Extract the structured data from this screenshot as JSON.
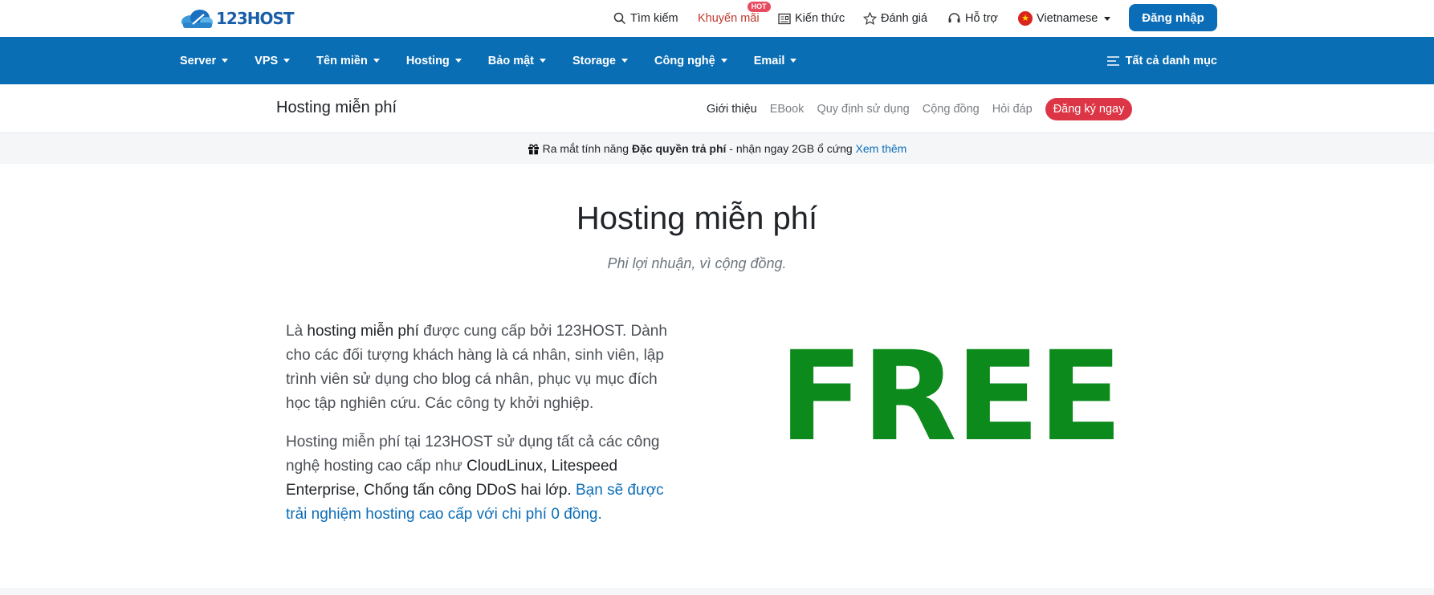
{
  "brand": {
    "logo_text": "123HOST"
  },
  "topbar": {
    "search_label": "Tìm kiếm",
    "promo_label": "Khuyến mãi",
    "promo_badge": "HOT",
    "knowledge_label": "Kiến thức",
    "review_label": "Đánh giá",
    "support_label": "Hỗ trợ",
    "language_label": "Vietnamese",
    "login_label": "Đăng nhập"
  },
  "mainnav": {
    "items": [
      {
        "label": "Server"
      },
      {
        "label": "VPS"
      },
      {
        "label": "Tên miền"
      },
      {
        "label": "Hosting"
      },
      {
        "label": "Bảo mật"
      },
      {
        "label": "Storage"
      },
      {
        "label": "Công nghệ"
      },
      {
        "label": "Email"
      }
    ],
    "all_categories_label": "Tất cả danh mục"
  },
  "subnav": {
    "title": "Hosting miễn phí",
    "links": [
      {
        "label": "Giới thiệu"
      },
      {
        "label": "EBook"
      },
      {
        "label": "Quy định sử dụng"
      },
      {
        "label": "Cộng đồng"
      },
      {
        "label": "Hỏi đáp"
      }
    ],
    "register_label": "Đăng ký ngay"
  },
  "announcement": {
    "prefix": "Ra mắt tính năng",
    "highlight": "Đặc quyền trả phí",
    "suffix": "- nhận ngay 2GB ổ cứng",
    "link_label": "Xem thêm"
  },
  "hero": {
    "title": "Hosting miễn phí",
    "subtitle": "Phi lợi nhuận, vì cộng đồng."
  },
  "content": {
    "p1_prefix": "Là",
    "p1_strong": "hosting miễn phí",
    "p1_rest": "được cung cấp bởi 123HOST. Dành cho các đối tượng khách hàng là cá nhân, sinh viên, lập trình viên sử dụng cho blog cá nhân, phục vụ mục đích học tập nghiên cứu. Các công ty khởi nghiệp.",
    "p2_prefix": "Hosting miễn phí tại 123HOST sử dụng tất cả các công nghệ hosting cao cấp như",
    "p2_strong": "CloudLinux, Litespeed Enterprise, Chống tấn công DDoS hai lớp.",
    "p2_link": "Bạn sẽ được trải nghiệm hosting cao cấp với chi phí 0 đồng.",
    "free_graphic_text": "FREE"
  },
  "colors": {
    "brand_blue": "#0a6eb5",
    "danger": "#dc3545",
    "free_green": "#0c8a1c"
  }
}
